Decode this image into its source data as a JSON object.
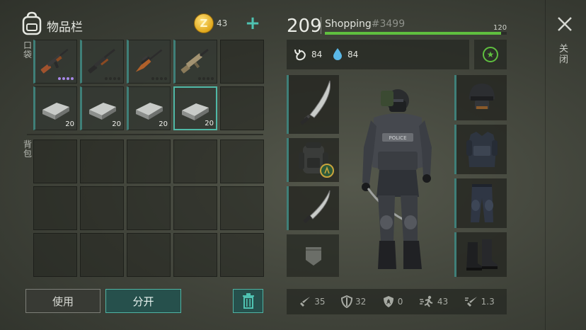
{
  "inventory": {
    "title": "物品栏",
    "coins": "43",
    "add_symbol": "+",
    "pocket_label": "口袋",
    "backpack_label": "背包",
    "pocket_items": [
      {
        "name": "ak-rifle",
        "qty": "",
        "rarity_dots": [
          "purple",
          "purple",
          "purple",
          "purple"
        ]
      },
      {
        "name": "pump-shotgun",
        "qty": "",
        "rarity_dots": [
          "dark",
          "dark",
          "dark",
          "dark"
        ]
      },
      {
        "name": "bolt-rifle",
        "qty": "",
        "rarity_dots": [
          "dark",
          "dark",
          "dark",
          "dark"
        ]
      },
      {
        "name": "tactical-rifle",
        "qty": "",
        "rarity_dots": [
          "dark",
          "dark",
          "dark",
          "dark"
        ]
      },
      {
        "name": "empty",
        "qty": ""
      },
      {
        "name": "iron-bar",
        "qty": "20"
      },
      {
        "name": "iron-bar",
        "qty": "20"
      },
      {
        "name": "iron-bar",
        "qty": "20"
      },
      {
        "name": "iron-bar",
        "qty": "20",
        "selected": true
      },
      {
        "name": "empty",
        "qty": ""
      }
    ],
    "use_label": "使用",
    "split_label": "分开"
  },
  "player": {
    "level": "209",
    "name": "Shopping",
    "id": "#3499",
    "xp_max": "120",
    "xp_fraction": 0.97,
    "hunger": "84",
    "thirst": "84"
  },
  "stats": [
    {
      "icon": "sword-icon",
      "value": "35"
    },
    {
      "icon": "shield-icon",
      "value": "32"
    },
    {
      "icon": "radiation-icon",
      "value": "0"
    },
    {
      "icon": "running-icon",
      "value": "43"
    },
    {
      "icon": "sword-speed-icon",
      "value": "1.3"
    }
  ],
  "close_label": "关闭",
  "colors": {
    "accent": "#4fb3a3",
    "xp_green": "#5fbf3f",
    "rarity_purple": "#a788e8"
  }
}
